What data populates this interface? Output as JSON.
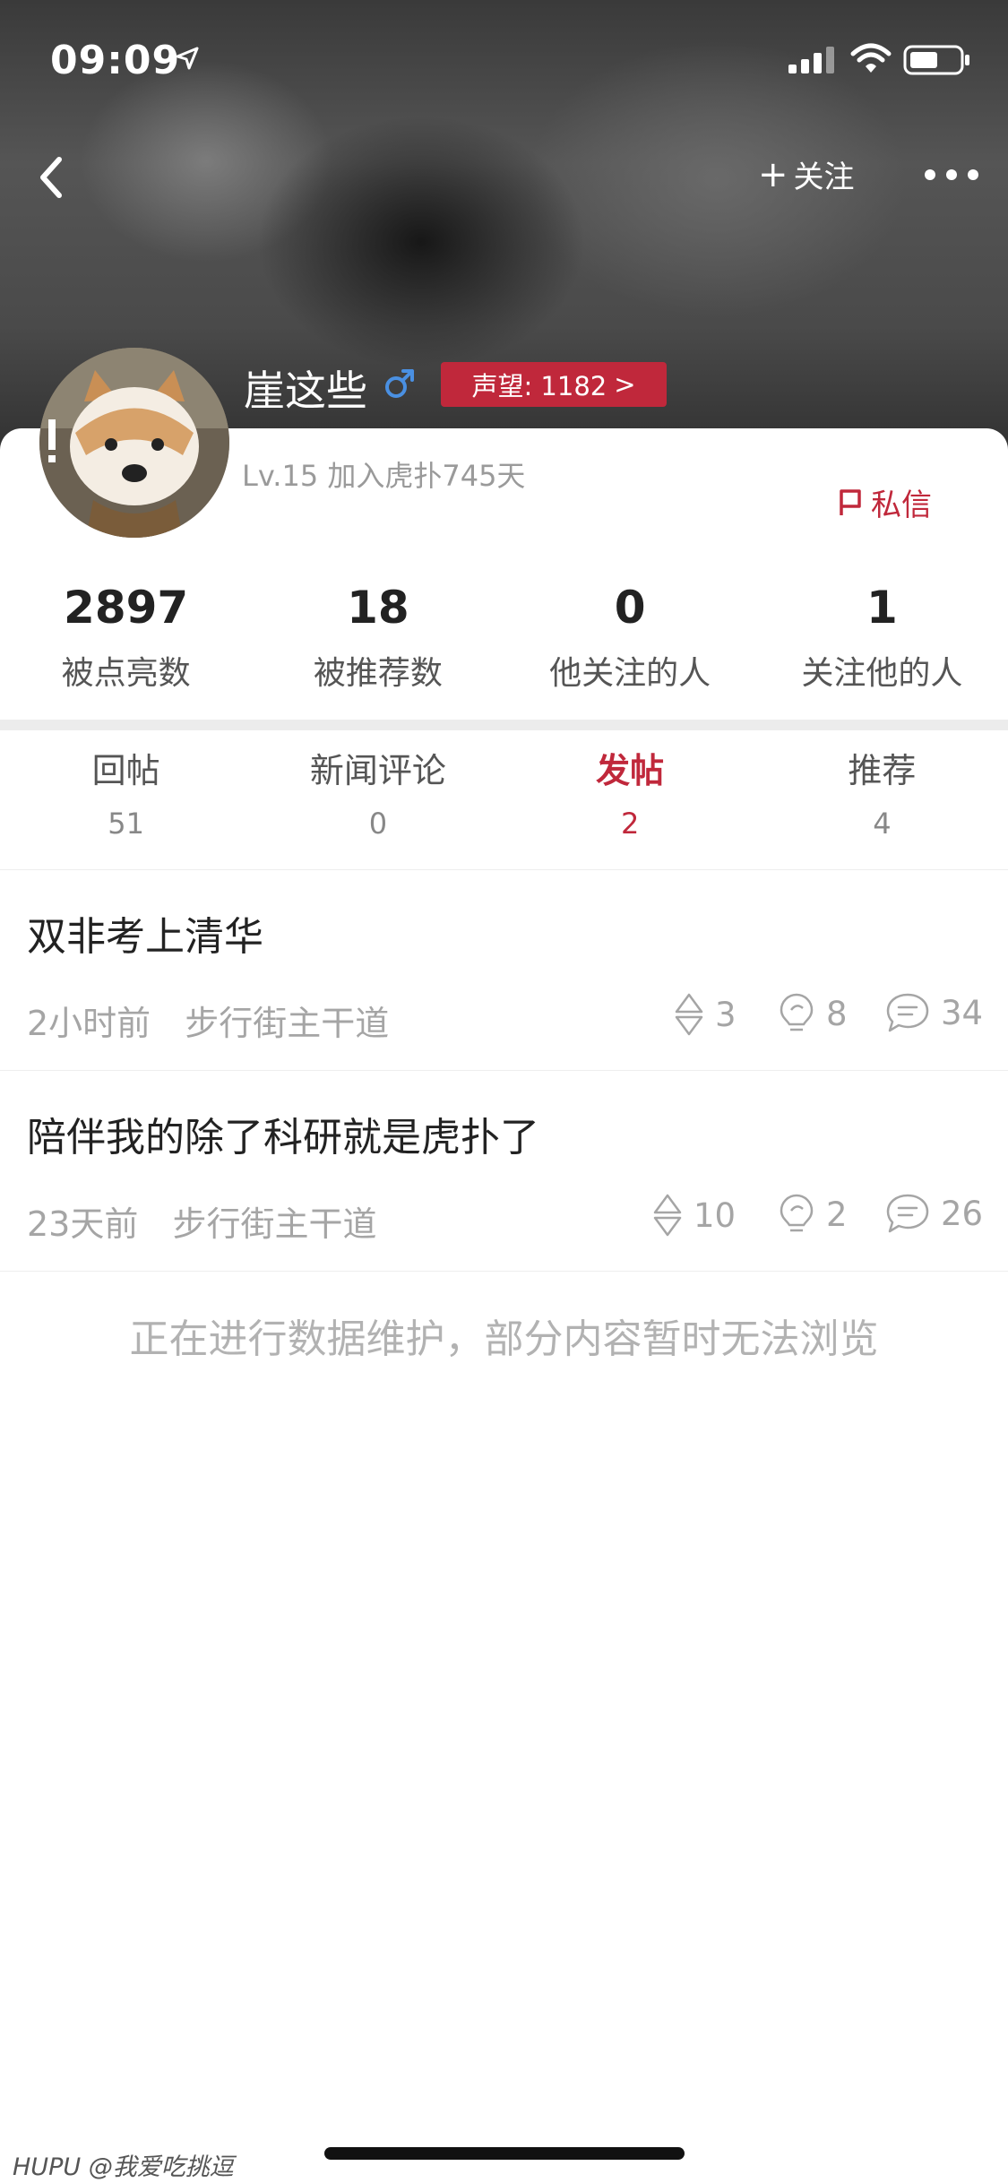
{
  "status_bar": {
    "time": "09:09"
  },
  "header": {
    "follow_label": "关注",
    "username": "崖这些",
    "prestige_label": "声望: 1182",
    "prestige_arrow": ">"
  },
  "profile": {
    "level_line": "Lv.15 加入虎扑745天",
    "message_label": "私信"
  },
  "stats": [
    {
      "value": "2897",
      "label": "被点亮数"
    },
    {
      "value": "18",
      "label": "被推荐数"
    },
    {
      "value": "0",
      "label": "他关注的人"
    },
    {
      "value": "1",
      "label": "关注他的人"
    }
  ],
  "tabs": [
    {
      "label": "回帖",
      "count": "51",
      "active": false
    },
    {
      "label": "新闻评论",
      "count": "0",
      "active": false
    },
    {
      "label": "发帖",
      "count": "2",
      "active": true
    },
    {
      "label": "推荐",
      "count": "4",
      "active": false
    }
  ],
  "posts": [
    {
      "title": "双非考上清华",
      "time": "2小时前",
      "board": "步行街主干道",
      "recommend": "3",
      "light": "8",
      "replies": "34"
    },
    {
      "title": "陪伴我的除了科研就是虎扑了",
      "time": "23天前",
      "board": "步行街主干道",
      "recommend": "10",
      "light": "2",
      "replies": "26"
    }
  ],
  "notice": "正在进行数据维护，部分内容暂时无法浏览",
  "watermark": "HUPU @我爱吃挑逗",
  "colors": {
    "accent": "#c0283b",
    "gender": "#4a90e2"
  }
}
